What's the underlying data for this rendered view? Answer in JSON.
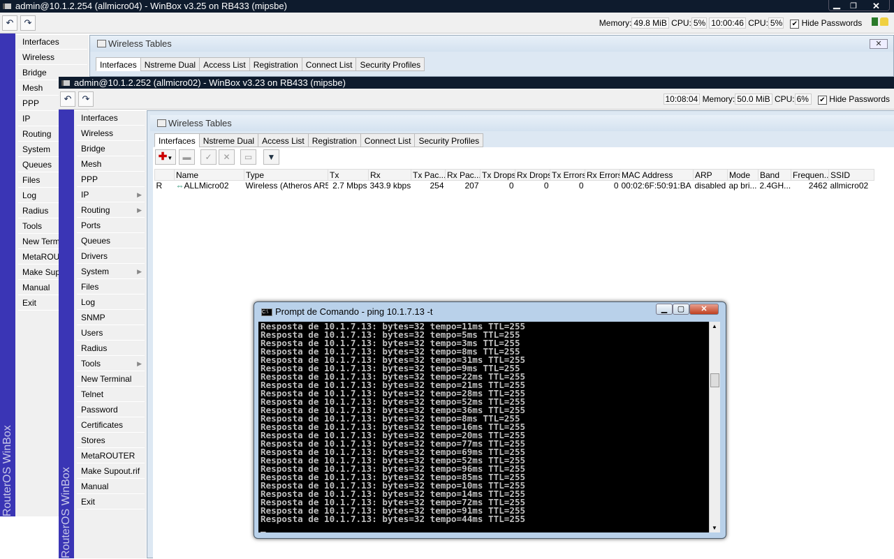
{
  "win1": {
    "title": "admin@10.1.2.254 (allmicro04) - WinBox v3.25 on RB433 (mipsbe)",
    "status": {
      "memory_label": "Memory:",
      "memory": "49.8 MiB",
      "cpu_label": "CPU:",
      "cpu": "5%",
      "time": "10:00:46",
      "cpu2": "5%",
      "hide_passwords": "Hide Passwords"
    },
    "strip_text": "RouterOS WinBox",
    "menu": [
      "Interfaces",
      "Wireless",
      "Bridge",
      "Mesh",
      "PPP",
      "IP",
      "Routing",
      "System",
      "Queues",
      "Files",
      "Log",
      "Radius",
      "Tools",
      "New Terminal",
      "MetaROUTER",
      "Make Supout.rif",
      "Manual",
      "Exit"
    ],
    "wireless_title": "Wireless Tables",
    "tabs": [
      "Interfaces",
      "Nstreme Dual",
      "Access List",
      "Registration",
      "Connect List",
      "Security Profiles"
    ]
  },
  "win2": {
    "title": "admin@10.1.2.252 (allmicro02) - WinBox v3.23 on RB433 (mipsbe)",
    "status": {
      "time": "10:08:04",
      "memory_label": "Memory:",
      "memory": "50.0 MiB",
      "cpu_label": "CPU:",
      "cpu": "6%",
      "hide_passwords": "Hide Passwords"
    },
    "strip_text": "RouterOS WinBox",
    "menu": [
      {
        "l": "Interfaces"
      },
      {
        "l": "Wireless"
      },
      {
        "l": "Bridge"
      },
      {
        "l": "Mesh"
      },
      {
        "l": "PPP"
      },
      {
        "l": "IP",
        "sub": true
      },
      {
        "l": "Routing",
        "sub": true
      },
      {
        "l": "Ports"
      },
      {
        "l": "Queues"
      },
      {
        "l": "Drivers"
      },
      {
        "l": "System",
        "sub": true
      },
      {
        "l": "Files"
      },
      {
        "l": "Log"
      },
      {
        "l": "SNMP"
      },
      {
        "l": "Users"
      },
      {
        "l": "Radius"
      },
      {
        "l": "Tools",
        "sub": true
      },
      {
        "l": "New Terminal"
      },
      {
        "l": "Telnet"
      },
      {
        "l": "Password"
      },
      {
        "l": "Certificates"
      },
      {
        "l": "Stores"
      },
      {
        "l": "MetaROUTER"
      },
      {
        "l": "Make Supout.rif"
      },
      {
        "l": "Manual"
      },
      {
        "l": "Exit"
      }
    ],
    "wireless_title": "Wireless Tables",
    "tabs": [
      "Interfaces",
      "Nstreme Dual",
      "Access List",
      "Registration",
      "Connect List",
      "Security Profiles"
    ],
    "columns": [
      "",
      "Name",
      "Type",
      "Tx",
      "Rx",
      "Tx Pac...",
      "Rx Pac...",
      "Tx Drops",
      "Rx Drops",
      "Tx Errors",
      "Rx Errors",
      "MAC Address",
      "ARP",
      "Mode",
      "Band",
      "Frequen...",
      "SSID"
    ],
    "rows": [
      [
        "R",
        "ALLMicro02",
        "Wireless (Atheros AR5...",
        "2.7 Mbps",
        "343.9 kbps",
        "254",
        "207",
        "0",
        "0",
        "0",
        "0",
        "00:02:6F:50:91:BA",
        "disabled",
        "ap bri...",
        "2.4GH...",
        "2462",
        "allmicro02"
      ]
    ]
  },
  "cmd": {
    "title": "Prompt de Comando - ping  10.1.7.13 -t",
    "line_prefix": "Resposta de 10.1.7.13: bytes=32 tempo=",
    "ttl": "TTL=255",
    "times_ms": [
      11,
      5,
      3,
      8,
      31,
      9,
      22,
      21,
      28,
      52,
      36,
      8,
      16,
      20,
      77,
      69,
      52,
      96,
      85,
      10,
      14,
      72,
      91,
      44
    ]
  }
}
